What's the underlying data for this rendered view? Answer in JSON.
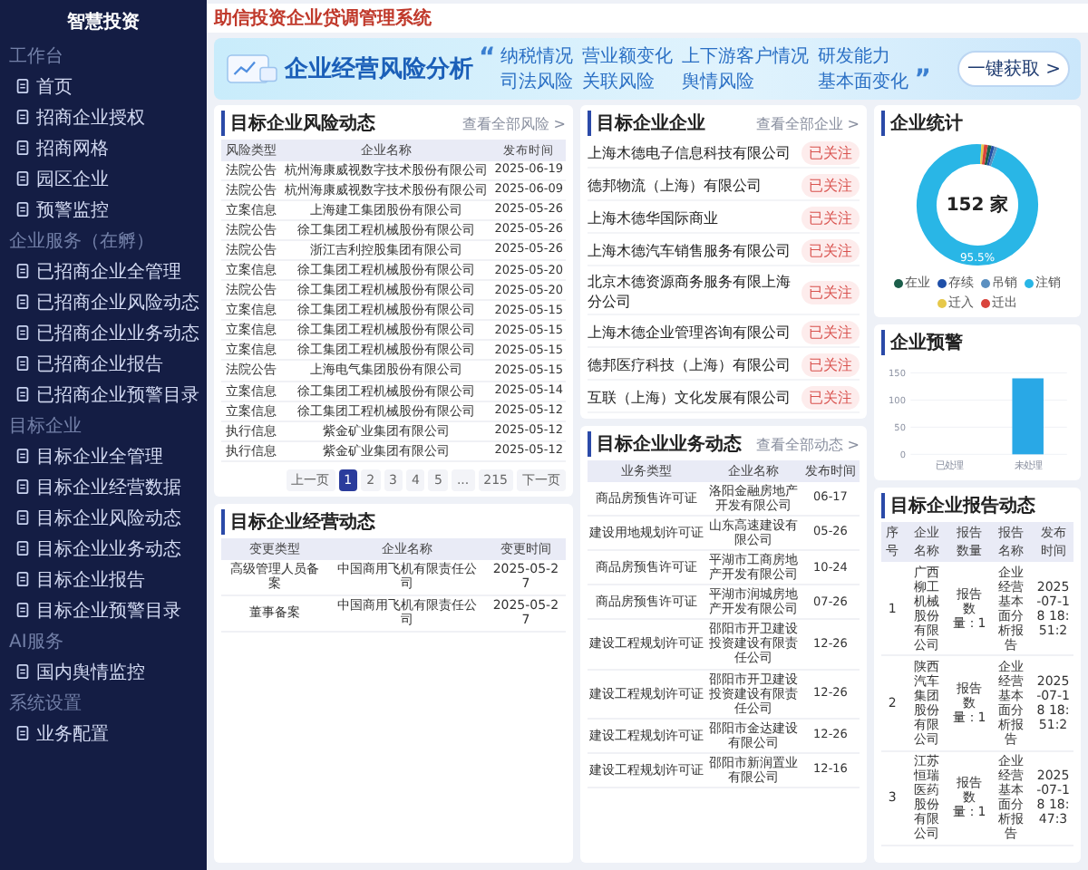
{
  "header": {
    "system_title": "助信投资企业贷调管理系统"
  },
  "sidebar": {
    "brand": "智慧投资",
    "sections": [
      {
        "heading": "工作台",
        "items": [
          {
            "label": "首页"
          },
          {
            "label": "招商企业授权"
          },
          {
            "label": "招商网格"
          },
          {
            "label": "园区企业"
          },
          {
            "label": "预警监控"
          }
        ]
      },
      {
        "heading": "企业服务（在孵）",
        "items": [
          {
            "label": "已招商企业全管理"
          },
          {
            "label": "已招商企业风险动态"
          },
          {
            "label": "已招商企业业务动态"
          },
          {
            "label": "已招商企业报告"
          },
          {
            "label": "已招商企业预警目录"
          }
        ]
      },
      {
        "heading": "目标企业",
        "items": [
          {
            "label": "目标企业全管理"
          },
          {
            "label": "目标企业经营数据"
          },
          {
            "label": "目标企业风险动态"
          },
          {
            "label": "目标企业业务动态"
          },
          {
            "label": "目标企业报告"
          },
          {
            "label": "目标企业预警目录"
          }
        ]
      },
      {
        "heading": "AI服务",
        "items": [
          {
            "label": "国内舆情监控"
          }
        ]
      },
      {
        "heading": "系统设置",
        "items": [
          {
            "label": "业务配置"
          }
        ]
      }
    ]
  },
  "banner": {
    "title": "企业经营风险分析",
    "open_quote": "“",
    "close_quote": "”",
    "topics": [
      "纳税情况",
      "司法风险",
      "营业额变化",
      "关联风险",
      "上下游客户情况",
      "舆情风险",
      "研发能力",
      "基本面变化"
    ],
    "button": "一键获取 >"
  },
  "risk_panel": {
    "title": "目标企业风险动态",
    "more_link": "查看全部风险 >",
    "columns": [
      "风险类型",
      "企业名称",
      "发布时间"
    ],
    "rows": [
      [
        "法院公告",
        "杭州海康威视数字技术股份有限公司",
        "2025-06-19"
      ],
      [
        "法院公告",
        "杭州海康威视数字技术股份有限公司",
        "2025-06-09"
      ],
      [
        "立案信息",
        "上海建工集团股份有限公司",
        "2025-05-26"
      ],
      [
        "法院公告",
        "徐工集团工程机械股份有限公司",
        "2025-05-26"
      ],
      [
        "法院公告",
        "浙江吉利控股集团有限公司",
        "2025-05-26"
      ],
      [
        "立案信息",
        "徐工集团工程机械股份有限公司",
        "2025-05-20"
      ],
      [
        "法院公告",
        "徐工集团工程机械股份有限公司",
        "2025-05-20"
      ],
      [
        "立案信息",
        "徐工集团工程机械股份有限公司",
        "2025-05-15"
      ],
      [
        "立案信息",
        "徐工集团工程机械股份有限公司",
        "2025-05-15"
      ],
      [
        "立案信息",
        "徐工集团工程机械股份有限公司",
        "2025-05-15"
      ],
      [
        "法院公告",
        "上海电气集团股份有限公司",
        "2025-05-15"
      ],
      [
        "立案信息",
        "徐工集团工程机械股份有限公司",
        "2025-05-14"
      ],
      [
        "立案信息",
        "徐工集团工程机械股份有限公司",
        "2025-05-12"
      ],
      [
        "执行信息",
        "紫金矿业集团有限公司",
        "2025-05-12"
      ],
      [
        "执行信息",
        "紫金矿业集团有限公司",
        "2025-05-12"
      ]
    ],
    "pagination": [
      {
        "label": "上一页",
        "selected": false
      },
      {
        "label": "1",
        "selected": true
      },
      {
        "label": "2",
        "selected": false
      },
      {
        "label": "3",
        "selected": false
      },
      {
        "label": "4",
        "selected": false
      },
      {
        "label": "5",
        "selected": false
      },
      {
        "label": "...",
        "selected": false
      },
      {
        "label": "215",
        "selected": false
      },
      {
        "label": "下一页",
        "selected": false
      }
    ]
  },
  "operations_panel": {
    "title": "目标企业经营动态",
    "columns": [
      "变更类型",
      "企业名称",
      "变更时间"
    ],
    "rows": [
      [
        "高级管理人员备案",
        "中国商用飞机有限责任公司",
        "2025-05-27"
      ],
      [
        "董事备案",
        "中国商用飞机有限责任公司",
        "2025-05-27"
      ]
    ]
  },
  "companies_panel": {
    "title": "目标企业企业",
    "more_link": "查看全部企业 >",
    "items": [
      {
        "name": "上海木德电子信息科技有限公司",
        "badge": "已关注"
      },
      {
        "name": "德邦物流（上海）有限公司",
        "badge": "已关注"
      },
      {
        "name": "上海木德华国际商业",
        "badge": "已关注"
      },
      {
        "name": "上海木德汽车销售服务有限公司",
        "badge": "已关注"
      },
      {
        "name": "北京木德资源商务服务有限上海分公司",
        "badge": "已关注"
      },
      {
        "name": "上海木德企业管理咨询有限公司",
        "badge": "已关注"
      },
      {
        "name": "德邦医疗科技（上海）有限公司",
        "badge": "已关注"
      },
      {
        "name": "互联（上海）文化发展有限公司",
        "badge": "已关注"
      }
    ]
  },
  "business_panel": {
    "title": "目标企业业务动态",
    "more_link": "查看全部动态 >",
    "columns": [
      "业务类型",
      "企业名称",
      "发布时间"
    ],
    "rows": [
      [
        "商品房预售许可证",
        "洛阳金融房地产开发有限公司",
        "06-17"
      ],
      [
        "建设用地规划许可证",
        "山东高速建设有限公司",
        "05-26"
      ],
      [
        "商品房预售许可证",
        "平湖市工商房地产开发有限公司",
        "10-24"
      ],
      [
        "商品房预售许可证",
        "平湖市润城房地产开发有限公司",
        "07-26"
      ],
      [
        "建设工程规划许可证",
        "邵阳市开卫建设投资建设有限责任公司",
        "12-26"
      ],
      [
        "建设工程规划许可证",
        "邵阳市开卫建设投资建设有限责任公司",
        "12-26"
      ],
      [
        "建设工程规划许可证",
        "邵阳市金达建设有限公司",
        "12-26"
      ],
      [
        "建设工程规划许可证",
        "邵阳市新润置业有限公司",
        "12-16"
      ]
    ]
  },
  "stats_panel": {
    "title": "企业统计",
    "center_label": "152 家",
    "slice_label": "95.5%",
    "legend": [
      {
        "label": "在业",
        "color": "#1b5e4a"
      },
      {
        "label": "存续",
        "color": "#1f4fa8"
      },
      {
        "label": "吊销",
        "color": "#5a8fc0"
      },
      {
        "label": "注销",
        "color": "#29b6e6"
      },
      {
        "label": "迁入",
        "color": "#e6c84a"
      },
      {
        "label": "迁出",
        "color": "#d9443c"
      }
    ]
  },
  "warning_panel": {
    "title": "企业预警",
    "chart_data": {
      "type": "bar",
      "categories": [
        "已处理",
        "未处理"
      ],
      "values": [
        0,
        140
      ],
      "yticks": [
        0,
        50,
        100,
        150
      ],
      "ylim": [
        0,
        150
      ]
    }
  },
  "reports_panel": {
    "title": "目标企业报告动态",
    "columns": [
      "序号",
      "企业名称",
      "报告数量",
      "报告名称",
      "发布时间"
    ],
    "rows": [
      [
        "1",
        "广西柳工机械股份有限公司",
        "报告数量：1",
        "企业经营基本面分析报告",
        "2025-07-18 18:51:2"
      ],
      [
        "2",
        "陕西汽车集团股份有限公司",
        "报告数量：1",
        "企业经营基本面分析报告",
        "2025-07-18 18:51:2"
      ],
      [
        "3",
        "江苏恒瑞医药股份有限公司",
        "报告数量：1",
        "企业经营基本面分析报告",
        "2025-07-18 18:47:3"
      ]
    ]
  }
}
